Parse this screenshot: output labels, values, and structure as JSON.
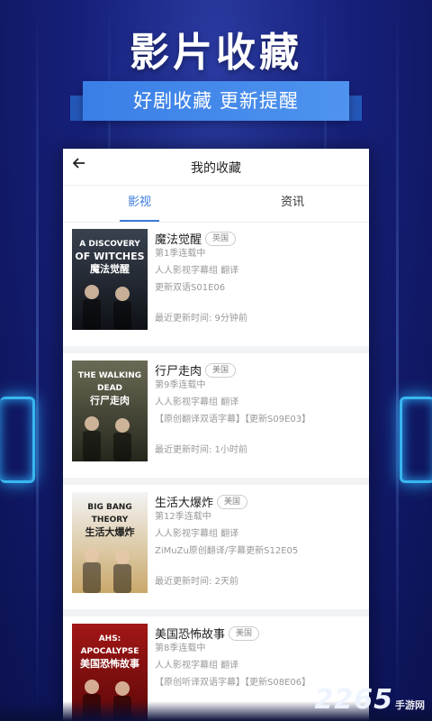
{
  "promo": {
    "headline": "影片收藏",
    "subheadline": "好剧收藏  更新提醒"
  },
  "app": {
    "back_icon": "arrow-left-icon",
    "title": "我的收藏",
    "tabs": [
      {
        "label": "影视",
        "active": true
      },
      {
        "label": "资讯",
        "active": false
      }
    ]
  },
  "favorites": [
    {
      "title": "魔法觉醒",
      "region": "英国",
      "season_status": "第1季连载中",
      "translator": "人人影视字幕组 翻译",
      "latest": "更新双语S01E06",
      "updated": "最近更新时间: 9分钟前",
      "poster_lines": [
        "A DISCOVERY",
        "OF WITCHES",
        "魔法觉醒"
      ],
      "poster_colors": [
        "#3a4250",
        "#0e1116"
      ]
    },
    {
      "title": "行尸走肉",
      "region": "美国",
      "season_status": "第9季连载中",
      "translator": "人人影视字幕组 翻译",
      "latest": "【原创翻译双语字幕】【更新S09E03】",
      "updated": "最近更新时间: 1小时前",
      "poster_lines": [
        "THE WALKING DEAD",
        "行尸走肉"
      ],
      "poster_colors": [
        "#6b6a55",
        "#25271c"
      ]
    },
    {
      "title": "生活大爆炸",
      "region": "美国",
      "season_status": "第12季连载中",
      "translator": "人人影视字幕组 翻译",
      "latest": "ZiMuZu原创翻译/字幕更新S12E05",
      "updated": "最近更新时间: 2天前",
      "poster_lines": [
        "BIG BANG THEORY",
        "生活大爆炸"
      ],
      "poster_colors": [
        "#f4f4f4",
        "#c9a86a"
      ]
    },
    {
      "title": "美国恐怖故事",
      "region": "美国",
      "season_status": "第8季连载中",
      "translator": "人人影视字幕组 翻译",
      "latest": "【原创听译双语字幕】【更新S08E06】",
      "updated": "",
      "poster_lines": [
        "AHS: APOCALYPSE",
        "美国恐怖故事"
      ],
      "poster_colors": [
        "#a31616",
        "#5a0808"
      ]
    }
  ],
  "watermark": {
    "number": "2265",
    "suffix": "手游网"
  }
}
